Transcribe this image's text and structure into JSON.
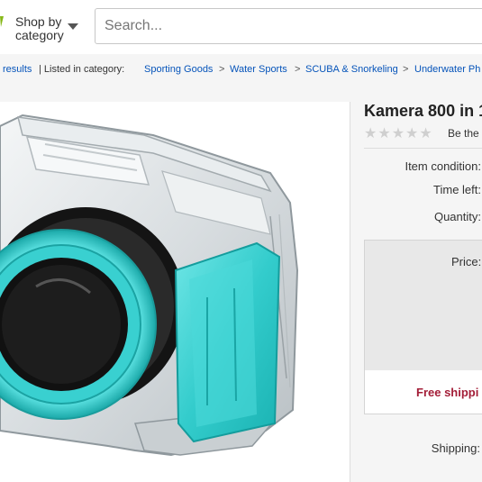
{
  "header": {
    "shop_by_line1": "Shop by",
    "shop_by_line2": "category",
    "search_placeholder": "Search...",
    "logo_color": "#86b817"
  },
  "breadcrumb": {
    "prev_text": "results",
    "listed_label": "| Listed in category:",
    "items": [
      "Sporting Goods",
      "Water Sports",
      "SCUBA & Snorkeling",
      "Underwater Ph"
    ],
    "separator": ">"
  },
  "product": {
    "title": "Kamera 800 in 1",
    "review_text": "Be the f",
    "rating_stars": 5,
    "rating_value": 0,
    "labels": {
      "condition": "Item condition:",
      "time_left": "Time left:",
      "quantity": "Quantity:",
      "price": "Price:",
      "free_shipping": "Free shippi",
      "shipping": "Shipping:"
    },
    "image_alt_icon": "underwater-camera-housing",
    "accent_color": "#3ccfcf",
    "free_shipping_color": "#a31d37",
    "link_color": "#0654ba"
  }
}
